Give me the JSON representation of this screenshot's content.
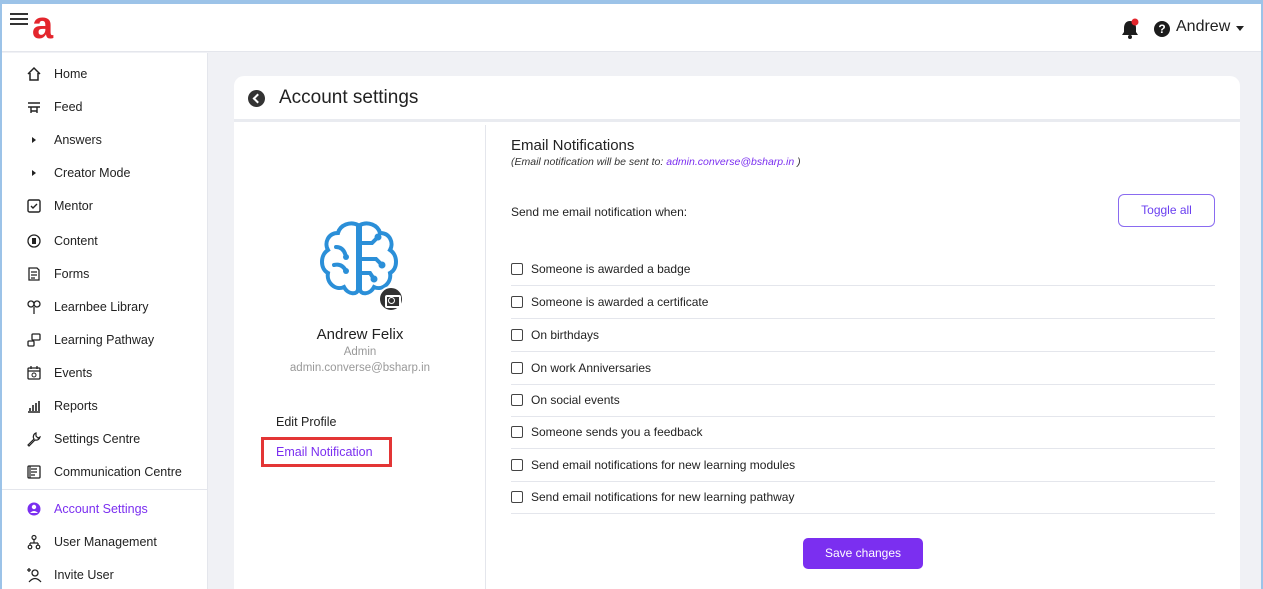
{
  "topbar": {
    "logo": "a",
    "user_name": "Andrew",
    "help_glyph": "?"
  },
  "sidebar": {
    "items": [
      {
        "label": "Home",
        "icon": "home-icon"
      },
      {
        "label": "Feed",
        "icon": "feed-icon"
      },
      {
        "label": "Answers",
        "icon": "caret-right-icon"
      },
      {
        "label": "Creator Mode",
        "icon": "caret-right-icon"
      },
      {
        "label": "Mentor",
        "icon": "checkbox-icon"
      },
      {
        "label": "Content",
        "icon": "content-icon"
      },
      {
        "label": "Forms",
        "icon": "forms-icon"
      },
      {
        "label": "Learnbee Library",
        "icon": "library-icon"
      },
      {
        "label": "Learning Pathway",
        "icon": "pathway-icon"
      },
      {
        "label": "Events",
        "icon": "calendar-icon"
      },
      {
        "label": "Reports",
        "icon": "reports-icon"
      },
      {
        "label": "Settings Centre",
        "icon": "wrench-icon"
      },
      {
        "label": "Communication Centre",
        "icon": "communication-icon"
      },
      {
        "label": "Account Settings",
        "icon": "account-settings-icon"
      },
      {
        "label": "User Management",
        "icon": "user-management-icon"
      },
      {
        "label": "Invite User",
        "icon": "invite-user-icon"
      }
    ],
    "active_label": "Account Settings",
    "accent_color": "#7b2ff0"
  },
  "page": {
    "title": "Account settings"
  },
  "profile": {
    "name": "Andrew Felix",
    "role": "Admin",
    "email": "admin.converse@bsharp.in",
    "links": {
      "edit_profile": "Edit Profile",
      "email_notification": "Email Notification"
    }
  },
  "notifications": {
    "title": "Email Notifications",
    "subtitle_prefix": "(Email notification will be sent to: ",
    "subtitle_email": "admin.converse@bsharp.in",
    "subtitle_suffix": " )",
    "send_when": "Send me email notification when:",
    "toggle_all": "Toggle all",
    "options": [
      "Someone is awarded a badge",
      "Someone is awarded a certificate",
      "On birthdays",
      "On work Anniversaries",
      "On social events",
      "Someone sends you a feedback",
      "Send email notifications for new learning modules",
      "Send email notifications for new learning pathway"
    ],
    "save_label": "Save changes"
  }
}
